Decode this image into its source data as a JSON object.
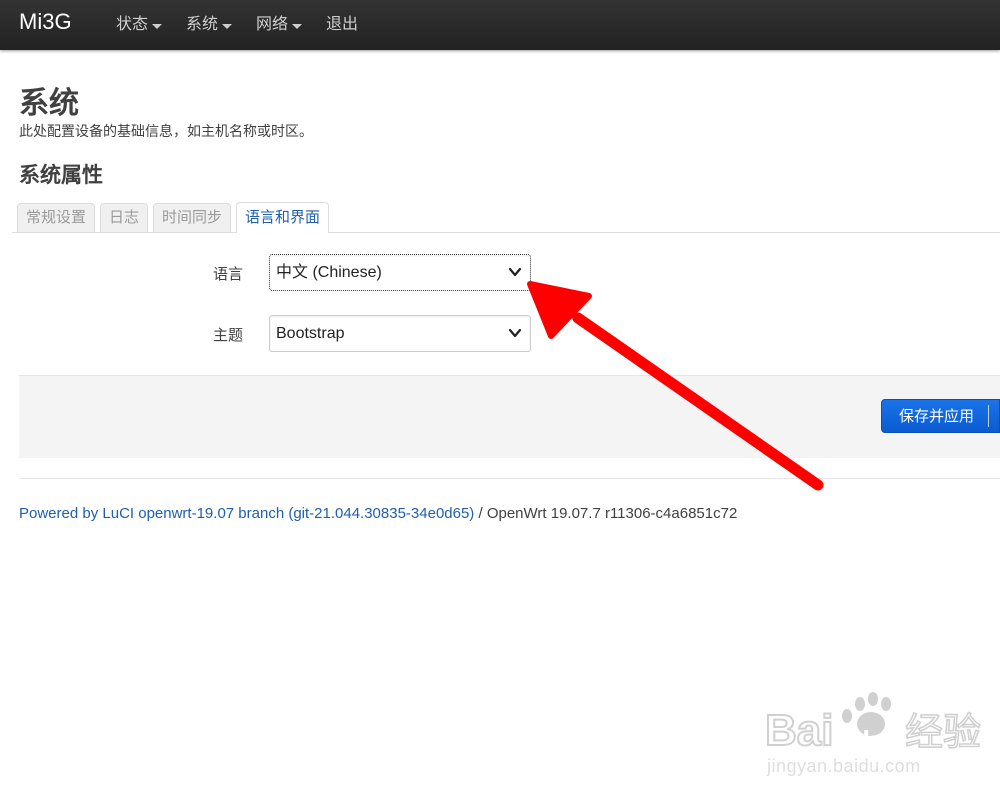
{
  "navbar": {
    "brand": "Mi3G",
    "items": [
      {
        "label": "状态",
        "has_dropdown": true
      },
      {
        "label": "系统",
        "has_dropdown": true
      },
      {
        "label": "网络",
        "has_dropdown": true
      },
      {
        "label": "退出",
        "has_dropdown": false
      }
    ]
  },
  "page": {
    "title": "系统",
    "description": "此处配置设备的基础信息，如主机名称或时区。",
    "section_title": "系统属性"
  },
  "tabs": [
    {
      "label": "常规设置",
      "active": false
    },
    {
      "label": "日志",
      "active": false
    },
    {
      "label": "时间同步",
      "active": false
    },
    {
      "label": "语言和界面",
      "active": true
    }
  ],
  "form": {
    "language": {
      "label": "语言",
      "value": "中文 (Chinese)"
    },
    "theme": {
      "label": "主题",
      "value": "Bootstrap"
    }
  },
  "actions": {
    "save_apply_label": "保存并应用"
  },
  "footer": {
    "link_text": "Powered by LuCI openwrt-19.07 branch (git-21.044.30835-34e0d65)",
    "separator": " / ",
    "version_text": "OpenWrt 19.07.7 r11306-c4a6851c72"
  },
  "watermark": {
    "logo_text": "Bai du 经验",
    "url_text": "jingyan.baidu.com"
  },
  "colors": {
    "navbar_bg": "#222222",
    "link": "#1f5fae",
    "primary_button": "#1a73e8",
    "annotation_arrow": "#ff0000"
  }
}
